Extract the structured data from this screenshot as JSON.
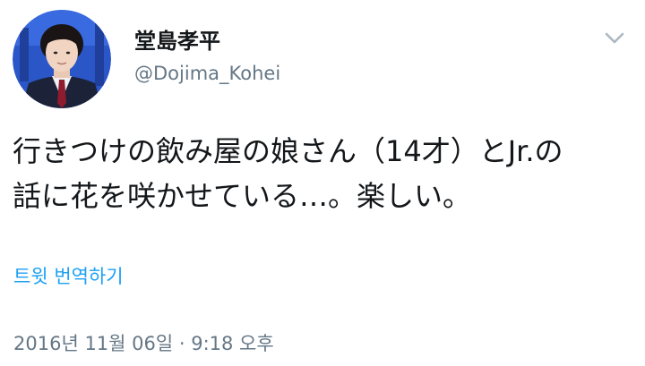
{
  "user": {
    "display_name": "堂島孝平",
    "handle": "@Dojima_Kohei",
    "avatar_icon": "profile-photo"
  },
  "header": {
    "menu_icon": "chevron-down-icon"
  },
  "tweet": {
    "text": "行きつけの飲み屋の娘さん（14才）とJr.の\n話に花を咲かせている…。楽しい。",
    "translate_label": "트윗 번역하기",
    "timestamp": "2016년 11월 06일 · 9:18 오후"
  },
  "colors": {
    "link": "#1da1f2",
    "secondary_text": "#657786",
    "primary_text": "#14171a"
  }
}
